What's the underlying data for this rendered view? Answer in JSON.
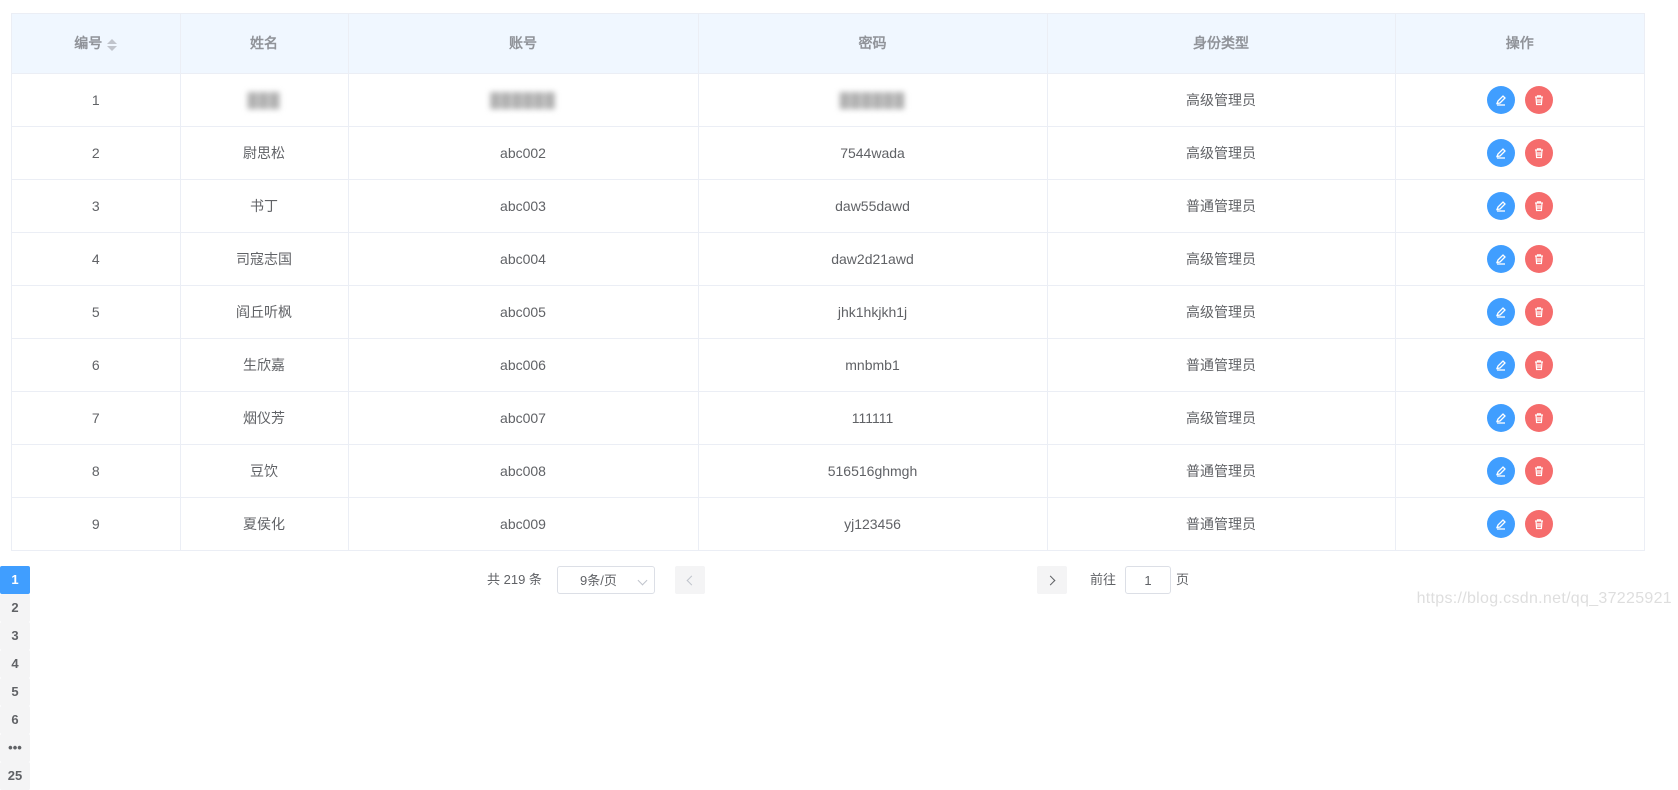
{
  "table": {
    "headers": [
      "编号",
      "姓名",
      "账号",
      "密码",
      "身份类型",
      "操作"
    ],
    "rows": [
      {
        "id": "1",
        "name": "███",
        "account": "██████",
        "password": "██████",
        "role": "高级管理员"
      },
      {
        "id": "2",
        "name": "尉思松",
        "account": "abc002",
        "password": "7544wada",
        "role": "高级管理员"
      },
      {
        "id": "3",
        "name": "书丁",
        "account": "abc003",
        "password": "daw55dawd",
        "role": "普通管理员"
      },
      {
        "id": "4",
        "name": "司寇志国",
        "account": "abc004",
        "password": "daw2d21awd",
        "role": "高级管理员"
      },
      {
        "id": "5",
        "name": "阎丘听枫",
        "account": "abc005",
        "password": "jhk1hkjkh1j",
        "role": "高级管理员"
      },
      {
        "id": "6",
        "name": "生欣嘉",
        "account": "abc006",
        "password": "mnbmb1",
        "role": "普通管理员"
      },
      {
        "id": "7",
        "name": "烟仪芳",
        "account": "abc007",
        "password": "111111",
        "role": "高级管理员"
      },
      {
        "id": "8",
        "name": "豆饮",
        "account": "abc008",
        "password": "516516ghmgh",
        "role": "普通管理员"
      },
      {
        "id": "9",
        "name": "夏侯化",
        "account": "abc009",
        "password": "yj123456",
        "role": "普通管理员"
      }
    ]
  },
  "pagination": {
    "total_text": "共 219 条",
    "page_size": "9条/页",
    "pages": [
      "1",
      "2",
      "3",
      "4",
      "5",
      "6",
      "•••",
      "25"
    ],
    "current_page": "1",
    "goto_label": "前往",
    "goto_value": "1",
    "goto_suffix": "页"
  },
  "watermark": "https://blog.csdn.net/qq_37225921",
  "colors": {
    "primary": "#409eff",
    "danger": "#f56c6c",
    "header_bg": "#f0f7ff"
  }
}
